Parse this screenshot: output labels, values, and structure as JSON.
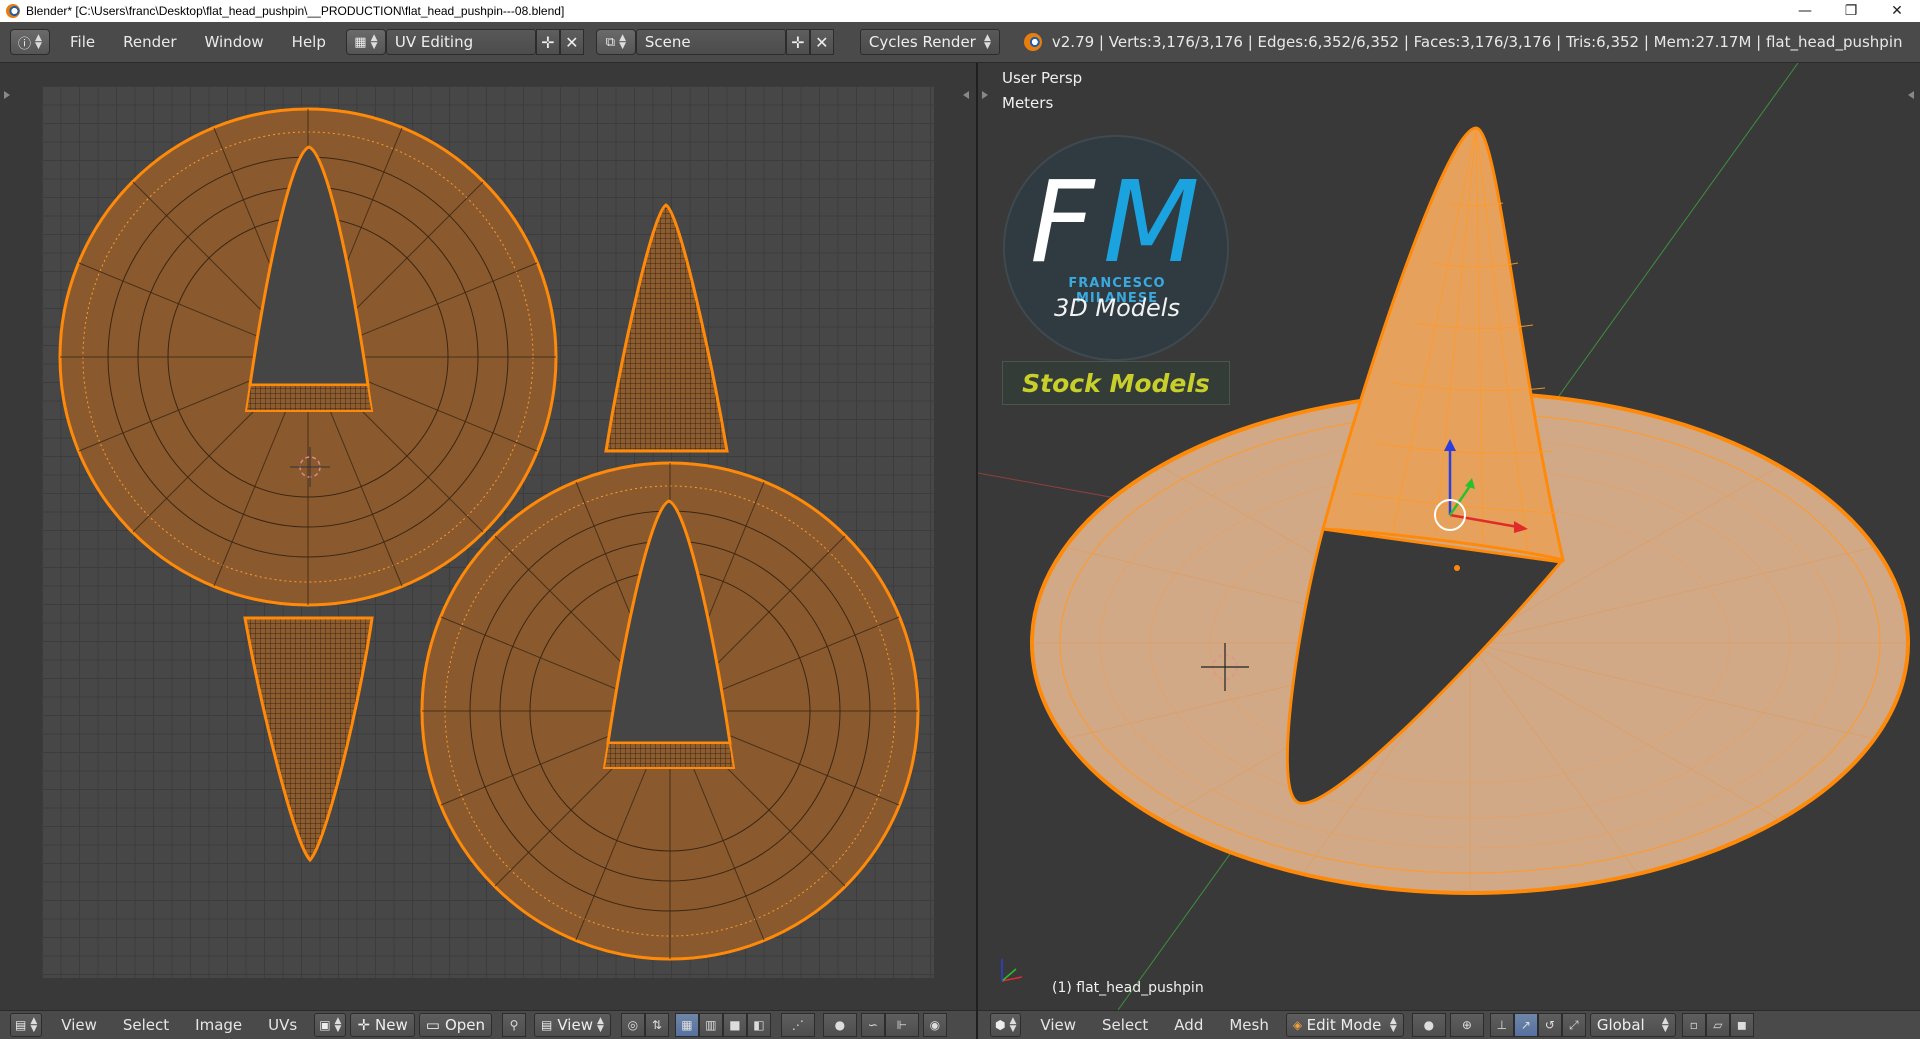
{
  "window": {
    "title": "Blender* [C:\\Users\\franc\\Desktop\\flat_head_pushpin\\__PRODUCTION\\flat_head_pushpin---08.blend]",
    "controls": [
      "—",
      "❐",
      "✕"
    ]
  },
  "info_header": {
    "menus": [
      "File",
      "Render",
      "Window",
      "Help"
    ],
    "layout": "UV Editing",
    "scene": "Scene",
    "engine": "Cycles Render",
    "stats": "v2.79 | Verts:3,176/3,176 | Edges:6,352/6,352 | Faces:3,176/3,176 | Tris:6,352 | Mem:27.17M | flat_head_pushpin"
  },
  "viewport": {
    "view_name": "User Persp",
    "units": "Meters",
    "object_label": "(1) flat_head_pushpin"
  },
  "logo": {
    "letter_f": "F",
    "letter_m": "M",
    "name": "FRANCESCO MILANESE",
    "tagline": "3D Models",
    "banner": "Stock Models"
  },
  "uv_footer": {
    "menus": [
      "View",
      "Select",
      "Image",
      "UVs"
    ],
    "new_label": "New",
    "open_label": "Open",
    "view_label": "View"
  },
  "view3d_footer": {
    "menus": [
      "View",
      "Select",
      "Add",
      "Mesh"
    ],
    "mode": "Edit Mode",
    "orientation": "Global"
  },
  "colors": {
    "mesh_orange": "#ff8a0a",
    "uv_fill": "#8a5a2e",
    "header": "#4a4a4a"
  }
}
